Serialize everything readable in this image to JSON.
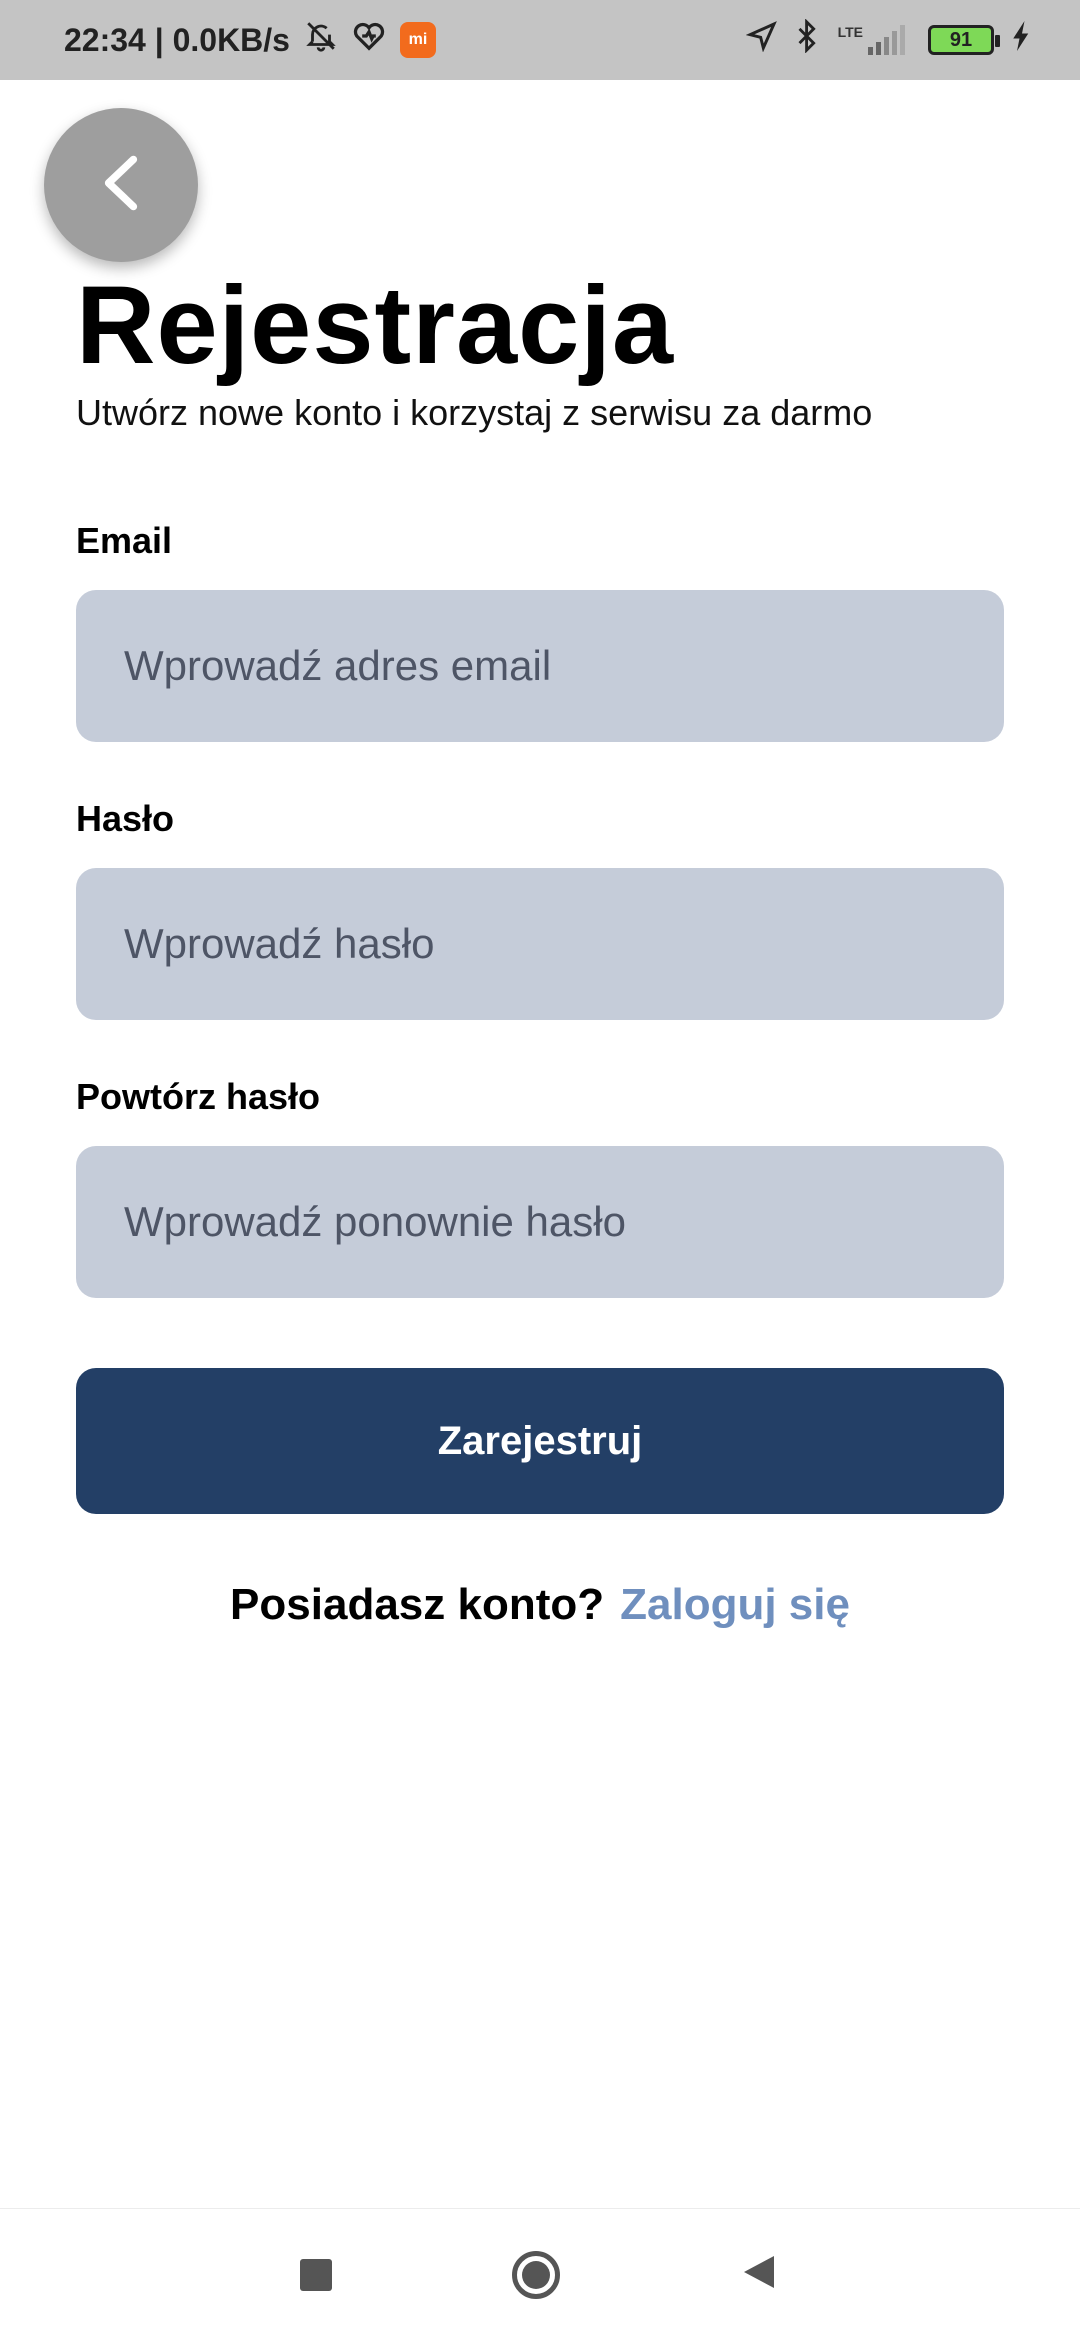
{
  "status_bar": {
    "time_speed": "22:34 | 0.0KB/s",
    "mi_icon_label": "mi",
    "network": "LTE",
    "battery": "91"
  },
  "header": {
    "title": "Rejestracja",
    "subtitle": "Utwórz nowe konto i korzystaj z serwisu za darmo"
  },
  "form": {
    "email_label": "Email",
    "email_placeholder": "Wprowadź adres email",
    "password_label": "Hasło",
    "password_placeholder": "Wprowadź hasło",
    "repeat_label": "Powtórz hasło",
    "repeat_placeholder": "Wprowadź ponownie hasło",
    "submit_label": "Zarejestruj"
  },
  "footer": {
    "question": "Posiadasz konto?",
    "login_link": "Zaloguj się"
  },
  "colors": {
    "status_bar": "#c4c4c4",
    "input_bg": "#c5ccd9",
    "button_bg": "#233f66",
    "link": "#6f8fbe"
  }
}
